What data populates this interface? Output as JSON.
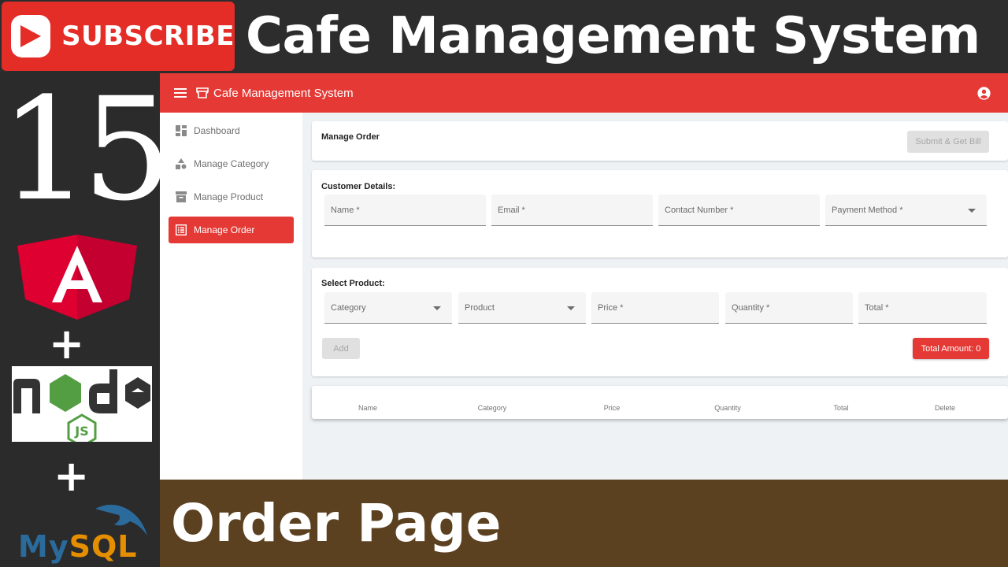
{
  "overlay": {
    "subscribe_label": "SUBSCRIBE",
    "banner_title": "Cafe Management System",
    "episode_number": "15",
    "plus_sign": "+",
    "node_badge": "JS",
    "mysql_my": "My",
    "mysql_sql": "SQL",
    "bottom_title": "Order Page"
  },
  "colors": {
    "primary": "#e53935",
    "subscribe_red": "#e52d27",
    "bottom_banner": "#5c4120",
    "angular_red": "#dd0031",
    "node_green": "#539e43"
  },
  "toolbar": {
    "title": "Cafe Management System",
    "menu_icon": "menu-icon",
    "store_icon": "storefront-icon",
    "account_icon": "account-circle-icon"
  },
  "sidebar": {
    "items": [
      {
        "label": "Dashboard",
        "icon": "dashboard-icon",
        "active": false
      },
      {
        "label": "Manage Category",
        "icon": "category-icon",
        "active": false
      },
      {
        "label": "Manage Product",
        "icon": "inventory-icon",
        "active": false
      },
      {
        "label": "Manage Order",
        "icon": "list-alt-icon",
        "active": true
      }
    ]
  },
  "manage_order": {
    "title": "Manage Order",
    "submit_label": "Submit & Get Bill"
  },
  "customer_details": {
    "title": "Customer Details:",
    "fields": {
      "name": "Name *",
      "email": "Email *",
      "contact": "Contact Number *",
      "payment": "Payment Method *"
    }
  },
  "select_product": {
    "title": "Select Product:",
    "fields": {
      "category": "Category",
      "product": "Product",
      "price": "Price *",
      "quantity": "Quantity *",
      "total": "Total *"
    },
    "add_label": "Add",
    "total_amount_label": "Total Amount: 0"
  },
  "table": {
    "columns": [
      "Name",
      "Category",
      "Price",
      "Quantity",
      "Total",
      "Delete"
    ]
  }
}
